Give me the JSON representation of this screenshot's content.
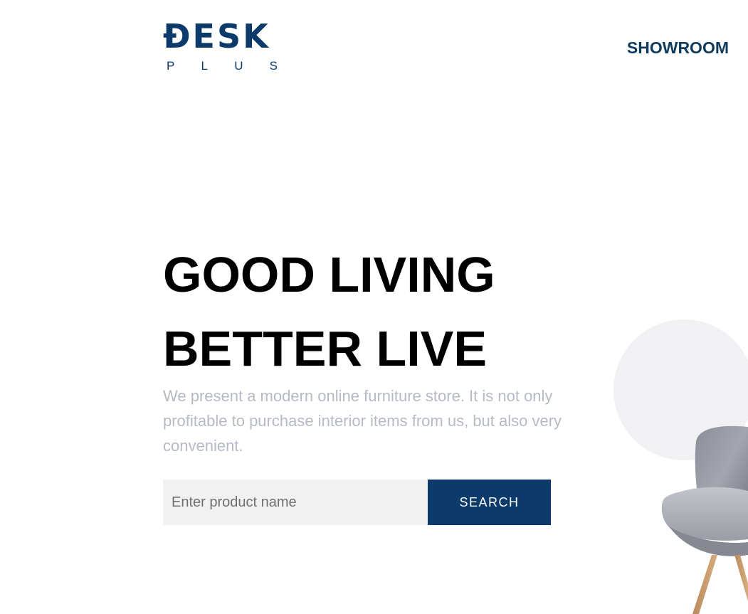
{
  "header": {
    "logo": {
      "main": "ĐESK",
      "sub_letters": [
        "P",
        "L",
        "U",
        "S"
      ]
    },
    "nav": {
      "showroom_label": "SHOWROOM"
    }
  },
  "hero": {
    "title_line1": "GOOD LIVING",
    "title_line2": "BETTER LIVE",
    "description": "We present a modern online furniture store. It is not only profitable to purchase interior items from us, but also very convenient."
  },
  "search": {
    "placeholder": "Enter product name",
    "value": "",
    "button_label": "SEARCH"
  },
  "colors": {
    "brand": "#0b3a6b",
    "nav_text": "#0d3b5f",
    "description_text": "#b6bac6",
    "input_bg": "#f1f1f1",
    "circle_bg": "#f1f1f4"
  },
  "icons": {
    "hero_image": "armchair-image"
  }
}
